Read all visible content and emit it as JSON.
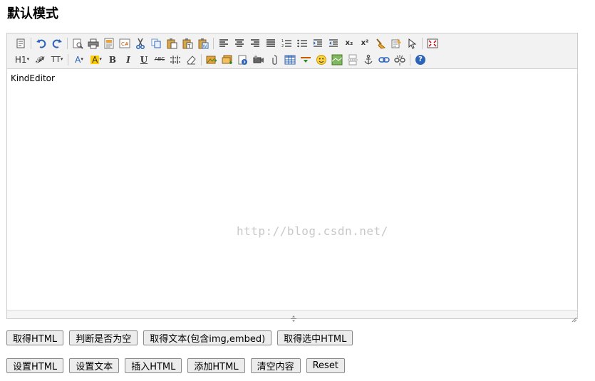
{
  "page": {
    "title": "默认模式"
  },
  "editor": {
    "content": "KindEditor",
    "watermark": "http://blog.csdn.net/"
  },
  "toolbar": {
    "row1": [
      "source-icon",
      "undo-icon",
      "redo-icon",
      "preview-icon",
      "print-icon",
      "template-icon",
      "code-icon",
      "cut-icon",
      "copy-icon",
      "paste-icon",
      "paste-plain-icon",
      "paste-word-icon",
      "align-left-icon",
      "align-center-icon",
      "align-right-icon",
      "justify-icon",
      "ordered-list-icon",
      "unordered-list-icon",
      "indent-icon",
      "outdent-icon",
      "subscript-icon",
      "superscript-icon",
      "clear-html-icon",
      "quick-format-icon",
      "select-all-icon",
      "fullscreen-icon"
    ],
    "row2": [
      "heading-icon",
      "font-name-icon",
      "font-size-icon",
      "fore-color-icon",
      "hilite-color-icon",
      "bold-icon",
      "italic-icon",
      "underline-icon",
      "strikethrough-icon",
      "line-height-icon",
      "remove-format-icon",
      "image-icon",
      "multi-image-icon",
      "flash-icon",
      "media-icon",
      "insert-file-icon",
      "table-icon",
      "hr-icon",
      "emoticons-icon",
      "baidu-map-icon",
      "page-break-icon",
      "anchor-icon",
      "link-icon",
      "unlink-icon",
      "about-icon"
    ],
    "labels": {
      "heading": "H1",
      "font_name": "𝓕",
      "font_size": "TT",
      "fore_color": "A",
      "hilite_color": "A",
      "bold": "B",
      "italic": "I",
      "underline": "U",
      "strike": "ABC",
      "subscript": "x₂",
      "superscript": "x²",
      "about": "?"
    },
    "colors": {
      "hilite": "#ffcc00",
      "accent_blue": "#2a63b8",
      "accent_orange": "#e8a33a"
    }
  },
  "buttons": {
    "row1": [
      "取得HTML",
      "判断是否为空",
      "取得文本(包含img,embed)",
      "取得选中HTML"
    ],
    "row2": [
      "设置HTML",
      "设置文本",
      "插入HTML",
      "添加HTML",
      "清空内容",
      "Reset"
    ]
  }
}
